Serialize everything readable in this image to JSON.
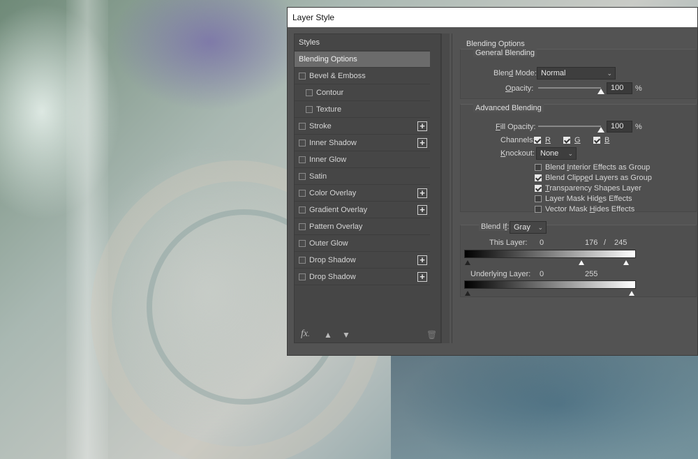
{
  "dialog": {
    "title": "Layer Style"
  },
  "styles_panel": {
    "header": "Styles",
    "items": [
      {
        "label": "Blending Options",
        "checkbox": false,
        "plus": false,
        "selected": true,
        "indent": 0
      },
      {
        "label": "Bevel & Emboss",
        "checkbox": true,
        "plus": false,
        "selected": false,
        "indent": 0
      },
      {
        "label": "Contour",
        "checkbox": true,
        "plus": false,
        "selected": false,
        "indent": 1
      },
      {
        "label": "Texture",
        "checkbox": true,
        "plus": false,
        "selected": false,
        "indent": 1
      },
      {
        "label": "Stroke",
        "checkbox": true,
        "plus": true,
        "selected": false,
        "indent": 0
      },
      {
        "label": "Inner Shadow",
        "checkbox": true,
        "plus": true,
        "selected": false,
        "indent": 0
      },
      {
        "label": "Inner Glow",
        "checkbox": true,
        "plus": false,
        "selected": false,
        "indent": 0
      },
      {
        "label": "Satin",
        "checkbox": true,
        "plus": false,
        "selected": false,
        "indent": 0
      },
      {
        "label": "Color Overlay",
        "checkbox": true,
        "plus": true,
        "selected": false,
        "indent": 0
      },
      {
        "label": "Gradient Overlay",
        "checkbox": true,
        "plus": true,
        "selected": false,
        "indent": 0
      },
      {
        "label": "Pattern Overlay",
        "checkbox": true,
        "plus": false,
        "selected": false,
        "indent": 0
      },
      {
        "label": "Outer Glow",
        "checkbox": true,
        "plus": false,
        "selected": false,
        "indent": 0
      },
      {
        "label": "Drop Shadow",
        "checkbox": true,
        "plus": true,
        "selected": false,
        "indent": 0
      },
      {
        "label": "Drop Shadow",
        "checkbox": true,
        "plus": true,
        "selected": false,
        "indent": 0
      }
    ],
    "footer": {
      "fx_label": "fx",
      "fx_suffix": "."
    }
  },
  "blending": {
    "section_title": "Blending Options",
    "general": {
      "title": "General Blending",
      "blend_mode_label_pre": "Blen",
      "blend_mode_label_u": "d",
      "blend_mode_label_post": " Mode:",
      "blend_mode_value": "Normal",
      "opacity_label_u": "O",
      "opacity_label_post": "pacity:",
      "opacity_value": "100",
      "opacity_pct": 100,
      "percent": "%"
    },
    "advanced": {
      "title": "Advanced Blending",
      "fill_label_u": "F",
      "fill_label_post": "ill Opacity:",
      "fill_value": "100",
      "fill_pct": 100,
      "percent": "%",
      "channels_label": "Channels:",
      "channels": [
        {
          "label": "R",
          "checked": true
        },
        {
          "label": "G",
          "checked": true
        },
        {
          "label": "B",
          "checked": true
        }
      ],
      "knockout_label_u": "K",
      "knockout_label_post": "nockout:",
      "knockout_value": "None",
      "options": [
        {
          "pre": "Blend ",
          "u": "I",
          "post": "nterior Effects as Group",
          "checked": false
        },
        {
          "pre": "Blend Clipp",
          "u": "e",
          "post": "d Layers as Group",
          "checked": true
        },
        {
          "pre": "",
          "u": "T",
          "post": "ransparency Shapes Layer",
          "checked": true
        },
        {
          "pre": "Layer Mask Hid",
          "u": "e",
          "post": "s Effects",
          "checked": false
        },
        {
          "pre": "Vector Mask ",
          "u": "H",
          "post": "ides Effects",
          "checked": false
        }
      ]
    },
    "blend_if": {
      "label_pre": "Blend I",
      "label_u": "f",
      "label_post": ":",
      "channel": "Gray",
      "this_layer": {
        "label": "This Layer:",
        "low": "0",
        "high_a": "176",
        "sep": "/",
        "high_b": "245"
      },
      "underlying": {
        "label": "Underlying Layer:",
        "low": "0",
        "high": "255"
      }
    }
  },
  "colors": {
    "dialog_bg": "#535353",
    "panel_bg": "#464646",
    "selected_bg": "#6b6b6b",
    "titlebar": "#ffffff"
  }
}
